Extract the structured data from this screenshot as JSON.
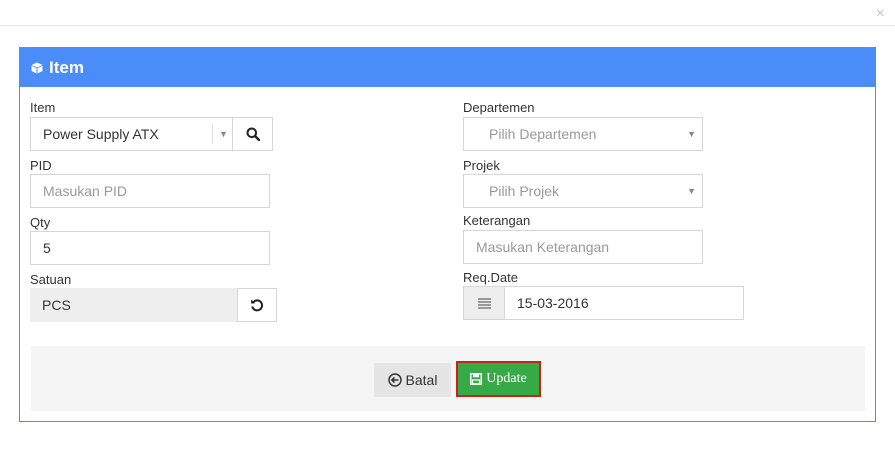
{
  "window": {
    "close_glyph": "×"
  },
  "panel": {
    "title": "Item",
    "title_icon": "cube-icon",
    "header_color": "#4b8df8"
  },
  "form": {
    "item": {
      "label": "Item",
      "value": "Power Supply ATX",
      "clear": "×"
    },
    "pid": {
      "label": "PID",
      "placeholder": "Masukan PID"
    },
    "qty": {
      "label": "Qty",
      "value": "5"
    },
    "satuan": {
      "label": "Satuan",
      "value": "PCS"
    },
    "departemen": {
      "label": "Departemen",
      "placeholder": "Pilih Departemen"
    },
    "projek": {
      "label": "Projek",
      "placeholder": "Pilih Projek"
    },
    "keterangan": {
      "label": "Keterangan",
      "placeholder": "Masukan Keterangan"
    },
    "req_date": {
      "label": "Req.Date",
      "value": "15-03-2016"
    }
  },
  "footer": {
    "cancel_label": "Batal",
    "update_label": "Update",
    "update_color": "#35aa47",
    "highlight_color": "#c4241b"
  }
}
